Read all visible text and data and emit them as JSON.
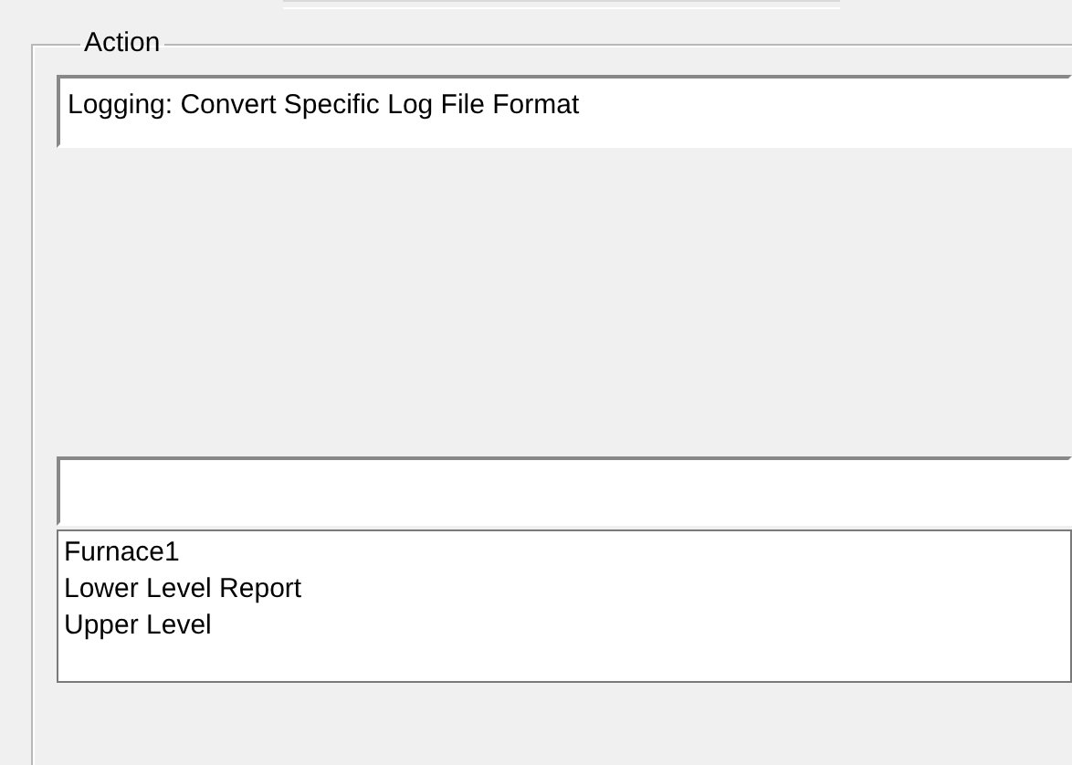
{
  "action_group": {
    "label": "Action",
    "action_field": {
      "value": "Logging: Convert Specific Log File Format"
    },
    "list": {
      "items": [
        {
          "label": "Furnace1",
          "selected": false
        },
        {
          "label": "Lower Level Report",
          "selected": false
        },
        {
          "label": "Upper Level",
          "selected": false
        }
      ]
    }
  }
}
